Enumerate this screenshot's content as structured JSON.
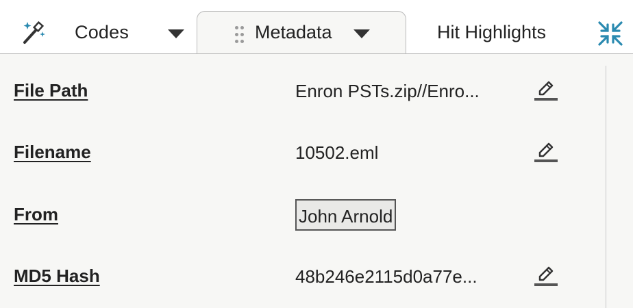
{
  "tabs": {
    "codes_label": "Codes",
    "metadata_label": "Metadata",
    "hit_highlights_label": "Hit Highlights",
    "active": "Metadata"
  },
  "icons": {
    "wand": "magic-wand-icon",
    "grip": "drag-handle-icon",
    "dropdown": "caret-down-icon",
    "collapse": "collapse-arrows-icon",
    "edit": "pencil-edit-icon"
  },
  "colors": {
    "accent": "#2a8ab0",
    "panel_background": "#f7f7f5",
    "text": "#222222"
  },
  "fields": [
    {
      "label": "File Path",
      "value": "Enron PSTs.zip//Enro...",
      "editable": true
    },
    {
      "label": "Filename",
      "value": "10502.eml",
      "editable": true
    },
    {
      "label": "From",
      "value": "John Arnold",
      "editable": false,
      "selected": true
    },
    {
      "label": "MD5 Hash",
      "value": "48b246e2115d0a77e...",
      "editable": true
    }
  ]
}
